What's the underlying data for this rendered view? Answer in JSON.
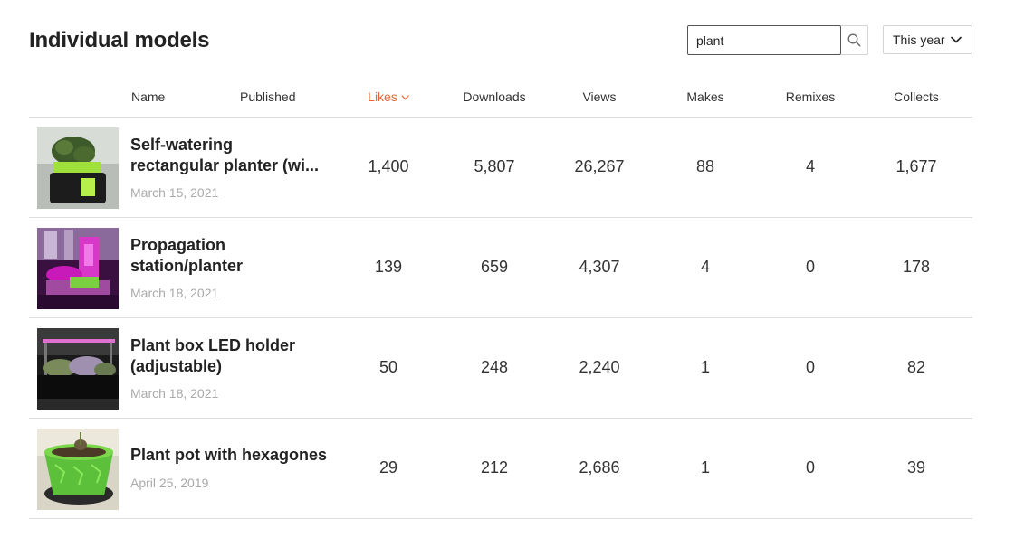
{
  "page": {
    "title": "Individual models"
  },
  "search": {
    "value": "plant"
  },
  "period": {
    "label": "This year"
  },
  "columns": {
    "name": "Name",
    "published": "Published",
    "likes": "Likes",
    "downloads": "Downloads",
    "views": "Views",
    "makes": "Makes",
    "remixes": "Remixes",
    "collects": "Collects"
  },
  "colors": {
    "accent": "#e8653a",
    "border": "#dedede",
    "muted": "#aaaaaa"
  },
  "icons": {
    "search": "search-icon",
    "dropdown": "chevron-down-icon",
    "sort": "sort-desc-icon"
  },
  "rows": [
    {
      "title_line1": "Self-watering",
      "title_line2": "rectangular planter (wi...",
      "date": "March 15, 2021",
      "likes": "1,400",
      "downloads": "5,807",
      "views": "26,267",
      "makes": "88",
      "remixes": "4",
      "collects": "1,677"
    },
    {
      "title_line1": "Propagation",
      "title_line2": "station/planter",
      "date": "March 18, 2021",
      "likes": "139",
      "downloads": "659",
      "views": "4,307",
      "makes": "4",
      "remixes": "0",
      "collects": "178"
    },
    {
      "title_line1": "Plant box LED holder",
      "title_line2": "(adjustable)",
      "date": "March 18, 2021",
      "likes": "50",
      "downloads": "248",
      "views": "2,240",
      "makes": "1",
      "remixes": "0",
      "collects": "82"
    },
    {
      "title_line1": "Plant pot with hexagones",
      "title_line2": "",
      "date": "April 25, 2019",
      "likes": "29",
      "downloads": "212",
      "views": "2,686",
      "makes": "1",
      "remixes": "0",
      "collects": "39"
    }
  ]
}
